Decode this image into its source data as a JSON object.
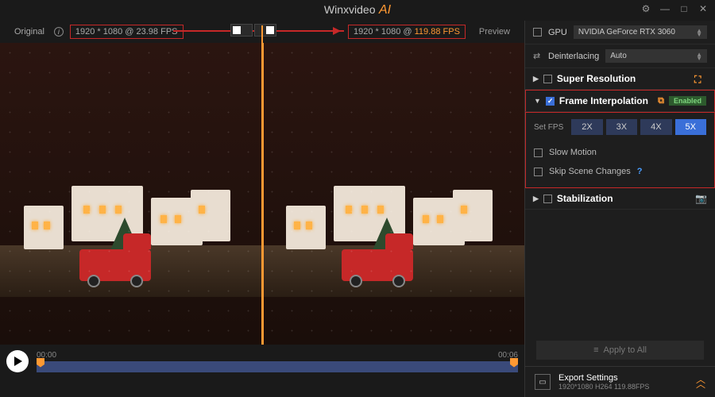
{
  "title": {
    "brand": "Winxvideo",
    "accent": "AI"
  },
  "info_bar": {
    "original_label": "Original",
    "preview_label": "Preview",
    "orig_res": "1920 * 1080 @ 23.98 FPS",
    "preview_res_prefix": "1920 * 1080 @ ",
    "preview_fps": "119.88 FPS"
  },
  "gpu": {
    "label": "GPU",
    "device": "NVIDIA GeForce RTX 3060"
  },
  "deinterlace": {
    "label": "Deinterlacing",
    "value": "Auto"
  },
  "sections": {
    "super_res": "Super Resolution",
    "frame_interp": "Frame Interpolation",
    "stabilization": "Stabilization",
    "enabled_badge": "Enabled"
  },
  "interp": {
    "set_fps_label": "Set FPS",
    "multipliers": [
      "2X",
      "3X",
      "4X",
      "5X"
    ],
    "active": "5X",
    "slow_motion": "Slow Motion",
    "skip_scene": "Skip Scene Changes"
  },
  "apply_all": "Apply to All",
  "timeline": {
    "start": "00:00",
    "end": "00:06"
  },
  "export": {
    "title": "Export Settings",
    "detail": "1920*1080  H264  119.88FPS"
  },
  "icons": {
    "gear": "gear-icon",
    "minimize": "minimize-icon",
    "maximize": "maximize-icon",
    "close": "close-icon",
    "info": "info-icon",
    "compare_left": "compare-left-icon",
    "compare_right": "compare-right-icon",
    "super_res": "super-res-icon",
    "interp": "interp-icon",
    "stabilize": "stabilize-icon",
    "play": "play-icon",
    "export": "export-icon",
    "expand": "expand-icon"
  }
}
